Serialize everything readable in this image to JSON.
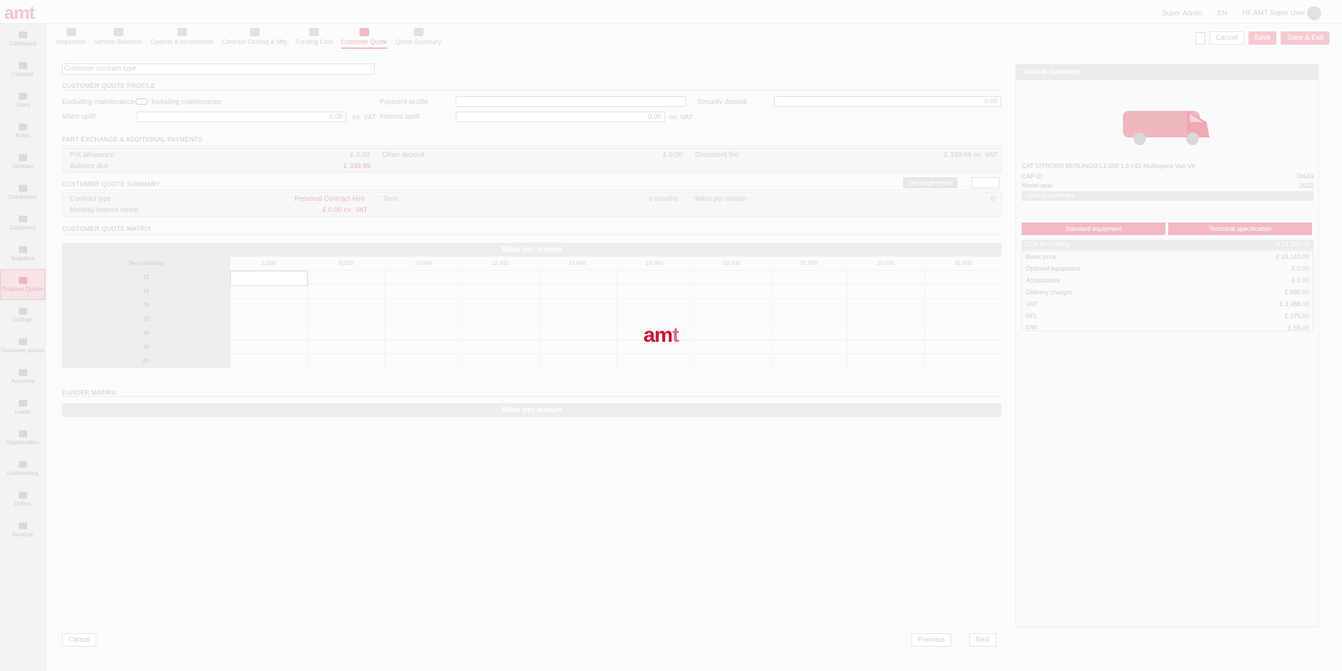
{
  "app": {
    "logo": "amt"
  },
  "topbar": {
    "user_left": "Super Admin",
    "lang": "EN",
    "user_right": "HF AMT Super User"
  },
  "sidebar": {
    "items": [
      {
        "label": "Dashboard"
      },
      {
        "label": "Contacts"
      },
      {
        "label": "Users"
      },
      {
        "label": "Rules"
      },
      {
        "label": "Vehicles"
      },
      {
        "label": "Companies"
      },
      {
        "label": "Customers"
      },
      {
        "label": "Suppliers"
      },
      {
        "label": "Proposal Quotes",
        "active": true
      },
      {
        "label": "Settings"
      },
      {
        "label": "Customer quotes"
      },
      {
        "label": "Accounts"
      },
      {
        "label": "Leads"
      },
      {
        "label": "Opportunities"
      },
      {
        "label": "Underwriting"
      },
      {
        "label": "Orders"
      },
      {
        "label": "Invoices"
      }
    ]
  },
  "steps": [
    {
      "label": "Acquisition"
    },
    {
      "label": "Vehicle Selection"
    },
    {
      "label": "Options & Accessories"
    },
    {
      "label": "Contract Costing & Mfg"
    },
    {
      "label": "Funding Cost"
    },
    {
      "label": "Customer Quote",
      "active": true
    },
    {
      "label": "Quote Summary"
    }
  ],
  "actions": {
    "cancel": "Cancel",
    "save": "Save",
    "save_exit": "Save & Exit"
  },
  "form": {
    "contract_type_placeholder": "Customer contract type",
    "profile_title": "CUSTOMER QUOTE PROFILE",
    "incl_maint_left": "Excluding maintenance",
    "incl_maint_right": "Including maintenance",
    "payment_profile": "Payment profile",
    "security_deposit": "Security deposit",
    "security_value": "0.00",
    "maint_uplift": "Maint uplift",
    "maint_value": "0.00",
    "ex_vat1": "ex. VAT",
    "interest_uplift": "Interest uplift",
    "interest_value": "0.00",
    "ex_vat2": "ex. VAT",
    "px_title": "PART EXCHANGE & ADDITIONAL PAYMENTS",
    "px_label": "P/X allowance",
    "px_value": "£ 0.00",
    "other_deposit": "Other deposit",
    "other_deposit_value": "£ 0.00",
    "document_fee": "Document fee",
    "document_fee_value": "£ 339.99",
    "document_fee_vat": "ex. VAT",
    "balance_due": "Balance due",
    "balance_due_value": "£ 339.99",
    "summary_title": "CUSTOMER QUOTE SUMMARY",
    "set_target": "Set target rental",
    "contract_type": "Contract type",
    "contract_type_value": "Personal Contract Hire",
    "term": "Term",
    "term_value": "0 months",
    "miles_pa": "Miles per annum",
    "miles_pa_value": "0",
    "monthly_rental": "Monthly finance rental",
    "monthly_rental_value": "£ 0.00 ex. VAT",
    "matrix_title": "CUSTOMER QUOTE MATRIX",
    "funder_title": "FUNDER MATRIX",
    "prev": "Previous",
    "next": "Next",
    "cancel_bottom": "Cancel"
  },
  "matrix": {
    "header": "Miles per annum",
    "term_label": "Term (months)",
    "columns": [
      "5,000",
      "8,000",
      "10,000",
      "12,000",
      "15,000",
      "18,000",
      "20,000",
      "25,000",
      "30,000",
      "35,000"
    ],
    "rows": [
      "12",
      "18",
      "24",
      "30",
      "36",
      "48",
      "60"
    ],
    "funder_header": "Miles per annum"
  },
  "overlay": {
    "logo_a": "am",
    "logo_b": "t"
  },
  "vehicle": {
    "title": "Vehicle summary",
    "description": "CAT CITROEN BERLINGO L1 650 1.6 HDi Multispace Van Vtr",
    "cap_id_label": "CAP ID",
    "cap_id": "78643",
    "model_year_label": "Model year",
    "model_year": "2022",
    "options_summary": "Options summary",
    "standard_equipment": "Standard equipment",
    "technical_spec": "Technical specification",
    "otr_label": "OTR for funding",
    "otr_value": "£ 21,308.00",
    "lines": [
      {
        "k": "Basic price",
        "v": "£ 16,140.00"
      },
      {
        "k": "Optional equipment",
        "v": "£ 0.00"
      },
      {
        "k": "Accessories",
        "v": "£ 0.00"
      },
      {
        "k": "Delivery charges",
        "v": "£ 695.00"
      },
      {
        "k": "VAT",
        "v": "£ 3,488.00"
      },
      {
        "k": "RFL",
        "v": "£ 275.00"
      },
      {
        "k": "FRF",
        "v": "£ 55.00"
      }
    ]
  },
  "colors": {
    "accent": "#cc1233",
    "accent_faded": "#f3bac3"
  }
}
